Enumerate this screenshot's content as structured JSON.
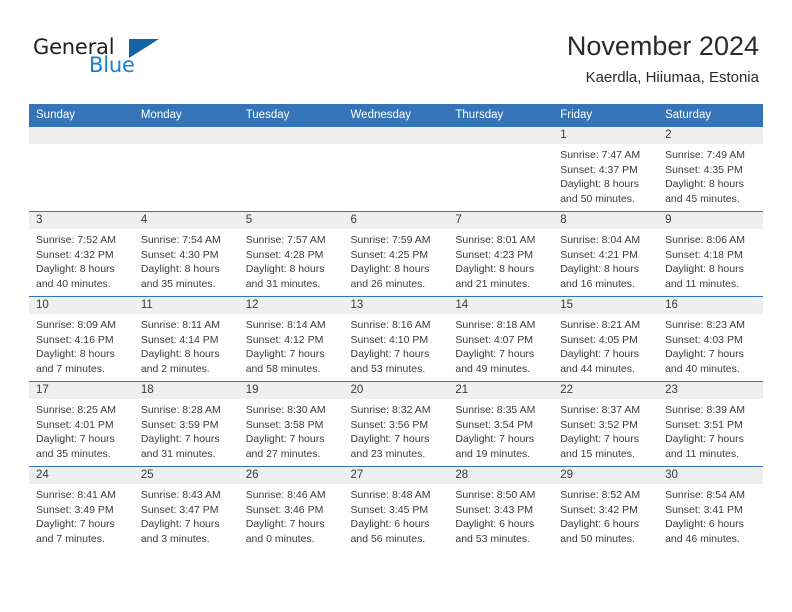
{
  "brand": {
    "logo_text_primary": "General",
    "logo_text_secondary": "Blue",
    "primary_color": "#231f20",
    "secondary_color": "#1a7fd4",
    "triangle_color": "#1464a5"
  },
  "header": {
    "title": "November 2024",
    "subtitle": "Kaerdla, Hiiumaa, Estonia"
  },
  "calendar": {
    "header_bg": "#3575b7",
    "daynum_bg": "#efefef",
    "weekday_labels": [
      "Sunday",
      "Monday",
      "Tuesday",
      "Wednesday",
      "Thursday",
      "Friday",
      "Saturday"
    ],
    "weeks": [
      [
        {
          "day": "",
          "blank": true,
          "sunrise": "",
          "sunset": "",
          "daylight_line1": "",
          "daylight_line2": ""
        },
        {
          "day": "",
          "blank": true,
          "sunrise": "",
          "sunset": "",
          "daylight_line1": "",
          "daylight_line2": ""
        },
        {
          "day": "",
          "blank": true,
          "sunrise": "",
          "sunset": "",
          "daylight_line1": "",
          "daylight_line2": ""
        },
        {
          "day": "",
          "blank": true,
          "sunrise": "",
          "sunset": "",
          "daylight_line1": "",
          "daylight_line2": ""
        },
        {
          "day": "",
          "blank": true,
          "sunrise": "",
          "sunset": "",
          "daylight_line1": "",
          "daylight_line2": ""
        },
        {
          "day": "1",
          "blank": false,
          "sunrise": "Sunrise: 7:47 AM",
          "sunset": "Sunset: 4:37 PM",
          "daylight_line1": "Daylight: 8 hours",
          "daylight_line2": "and 50 minutes."
        },
        {
          "day": "2",
          "blank": false,
          "sunrise": "Sunrise: 7:49 AM",
          "sunset": "Sunset: 4:35 PM",
          "daylight_line1": "Daylight: 8 hours",
          "daylight_line2": "and 45 minutes."
        }
      ],
      [
        {
          "day": "3",
          "blank": false,
          "sunrise": "Sunrise: 7:52 AM",
          "sunset": "Sunset: 4:32 PM",
          "daylight_line1": "Daylight: 8 hours",
          "daylight_line2": "and 40 minutes."
        },
        {
          "day": "4",
          "blank": false,
          "sunrise": "Sunrise: 7:54 AM",
          "sunset": "Sunset: 4:30 PM",
          "daylight_line1": "Daylight: 8 hours",
          "daylight_line2": "and 35 minutes."
        },
        {
          "day": "5",
          "blank": false,
          "sunrise": "Sunrise: 7:57 AM",
          "sunset": "Sunset: 4:28 PM",
          "daylight_line1": "Daylight: 8 hours",
          "daylight_line2": "and 31 minutes."
        },
        {
          "day": "6",
          "blank": false,
          "sunrise": "Sunrise: 7:59 AM",
          "sunset": "Sunset: 4:25 PM",
          "daylight_line1": "Daylight: 8 hours",
          "daylight_line2": "and 26 minutes."
        },
        {
          "day": "7",
          "blank": false,
          "sunrise": "Sunrise: 8:01 AM",
          "sunset": "Sunset: 4:23 PM",
          "daylight_line1": "Daylight: 8 hours",
          "daylight_line2": "and 21 minutes."
        },
        {
          "day": "8",
          "blank": false,
          "sunrise": "Sunrise: 8:04 AM",
          "sunset": "Sunset: 4:21 PM",
          "daylight_line1": "Daylight: 8 hours",
          "daylight_line2": "and 16 minutes."
        },
        {
          "day": "9",
          "blank": false,
          "sunrise": "Sunrise: 8:06 AM",
          "sunset": "Sunset: 4:18 PM",
          "daylight_line1": "Daylight: 8 hours",
          "daylight_line2": "and 11 minutes."
        }
      ],
      [
        {
          "day": "10",
          "blank": false,
          "sunrise": "Sunrise: 8:09 AM",
          "sunset": "Sunset: 4:16 PM",
          "daylight_line1": "Daylight: 8 hours",
          "daylight_line2": "and 7 minutes."
        },
        {
          "day": "11",
          "blank": false,
          "sunrise": "Sunrise: 8:11 AM",
          "sunset": "Sunset: 4:14 PM",
          "daylight_line1": "Daylight: 8 hours",
          "daylight_line2": "and 2 minutes."
        },
        {
          "day": "12",
          "blank": false,
          "sunrise": "Sunrise: 8:14 AM",
          "sunset": "Sunset: 4:12 PM",
          "daylight_line1": "Daylight: 7 hours",
          "daylight_line2": "and 58 minutes."
        },
        {
          "day": "13",
          "blank": false,
          "sunrise": "Sunrise: 8:16 AM",
          "sunset": "Sunset: 4:10 PM",
          "daylight_line1": "Daylight: 7 hours",
          "daylight_line2": "and 53 minutes."
        },
        {
          "day": "14",
          "blank": false,
          "sunrise": "Sunrise: 8:18 AM",
          "sunset": "Sunset: 4:07 PM",
          "daylight_line1": "Daylight: 7 hours",
          "daylight_line2": "and 49 minutes."
        },
        {
          "day": "15",
          "blank": false,
          "sunrise": "Sunrise: 8:21 AM",
          "sunset": "Sunset: 4:05 PM",
          "daylight_line1": "Daylight: 7 hours",
          "daylight_line2": "and 44 minutes."
        },
        {
          "day": "16",
          "blank": false,
          "sunrise": "Sunrise: 8:23 AM",
          "sunset": "Sunset: 4:03 PM",
          "daylight_line1": "Daylight: 7 hours",
          "daylight_line2": "and 40 minutes."
        }
      ],
      [
        {
          "day": "17",
          "blank": false,
          "sunrise": "Sunrise: 8:25 AM",
          "sunset": "Sunset: 4:01 PM",
          "daylight_line1": "Daylight: 7 hours",
          "daylight_line2": "and 35 minutes."
        },
        {
          "day": "18",
          "blank": false,
          "sunrise": "Sunrise: 8:28 AM",
          "sunset": "Sunset: 3:59 PM",
          "daylight_line1": "Daylight: 7 hours",
          "daylight_line2": "and 31 minutes."
        },
        {
          "day": "19",
          "blank": false,
          "sunrise": "Sunrise: 8:30 AM",
          "sunset": "Sunset: 3:58 PM",
          "daylight_line1": "Daylight: 7 hours",
          "daylight_line2": "and 27 minutes."
        },
        {
          "day": "20",
          "blank": false,
          "sunrise": "Sunrise: 8:32 AM",
          "sunset": "Sunset: 3:56 PM",
          "daylight_line1": "Daylight: 7 hours",
          "daylight_line2": "and 23 minutes."
        },
        {
          "day": "21",
          "blank": false,
          "sunrise": "Sunrise: 8:35 AM",
          "sunset": "Sunset: 3:54 PM",
          "daylight_line1": "Daylight: 7 hours",
          "daylight_line2": "and 19 minutes."
        },
        {
          "day": "22",
          "blank": false,
          "sunrise": "Sunrise: 8:37 AM",
          "sunset": "Sunset: 3:52 PM",
          "daylight_line1": "Daylight: 7 hours",
          "daylight_line2": "and 15 minutes."
        },
        {
          "day": "23",
          "blank": false,
          "sunrise": "Sunrise: 8:39 AM",
          "sunset": "Sunset: 3:51 PM",
          "daylight_line1": "Daylight: 7 hours",
          "daylight_line2": "and 11 minutes."
        }
      ],
      [
        {
          "day": "24",
          "blank": false,
          "sunrise": "Sunrise: 8:41 AM",
          "sunset": "Sunset: 3:49 PM",
          "daylight_line1": "Daylight: 7 hours",
          "daylight_line2": "and 7 minutes."
        },
        {
          "day": "25",
          "blank": false,
          "sunrise": "Sunrise: 8:43 AM",
          "sunset": "Sunset: 3:47 PM",
          "daylight_line1": "Daylight: 7 hours",
          "daylight_line2": "and 3 minutes."
        },
        {
          "day": "26",
          "blank": false,
          "sunrise": "Sunrise: 8:46 AM",
          "sunset": "Sunset: 3:46 PM",
          "daylight_line1": "Daylight: 7 hours",
          "daylight_line2": "and 0 minutes."
        },
        {
          "day": "27",
          "blank": false,
          "sunrise": "Sunrise: 8:48 AM",
          "sunset": "Sunset: 3:45 PM",
          "daylight_line1": "Daylight: 6 hours",
          "daylight_line2": "and 56 minutes."
        },
        {
          "day": "28",
          "blank": false,
          "sunrise": "Sunrise: 8:50 AM",
          "sunset": "Sunset: 3:43 PM",
          "daylight_line1": "Daylight: 6 hours",
          "daylight_line2": "and 53 minutes."
        },
        {
          "day": "29",
          "blank": false,
          "sunrise": "Sunrise: 8:52 AM",
          "sunset": "Sunset: 3:42 PM",
          "daylight_line1": "Daylight: 6 hours",
          "daylight_line2": "and 50 minutes."
        },
        {
          "day": "30",
          "blank": false,
          "sunrise": "Sunrise: 8:54 AM",
          "sunset": "Sunset: 3:41 PM",
          "daylight_line1": "Daylight: 6 hours",
          "daylight_line2": "and 46 minutes."
        }
      ]
    ]
  }
}
